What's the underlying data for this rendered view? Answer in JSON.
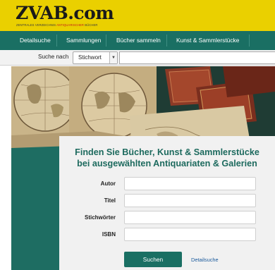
{
  "brand": {
    "logo_text": "ZVAB.com",
    "tagline_part1": "ZENTRALES VERZEICHNIS ",
    "tagline_part2": "ANTIQUARISCHER",
    "tagline_part3": " BÜCHER"
  },
  "nav": {
    "items": [
      "Detailsuche",
      "Sammlungen",
      "Bücher sammeln",
      "Kunst & Sammlerstücke"
    ]
  },
  "searchbar": {
    "label": "Suche nach",
    "select_value": "Stichwort",
    "input_value": ""
  },
  "hero": {
    "headline_line1": "Finden Sie Bücher, Kunst & Sammlerstücke",
    "headline_line2": "bei ausgewählten Antiquariaten & Galerien"
  },
  "form": {
    "fields": [
      {
        "label": "Autor",
        "value": ""
      },
      {
        "label": "Titel",
        "value": ""
      },
      {
        "label": "Stichwörter",
        "value": ""
      },
      {
        "label": "ISBN",
        "value": ""
      }
    ],
    "submit_label": "Suchen",
    "detail_link": "Detailsuche"
  },
  "colors": {
    "header_bg": "#ead000",
    "nav_bg": "#1a6f63",
    "headline": "#1d6a5e",
    "link": "#1a5a9c"
  }
}
